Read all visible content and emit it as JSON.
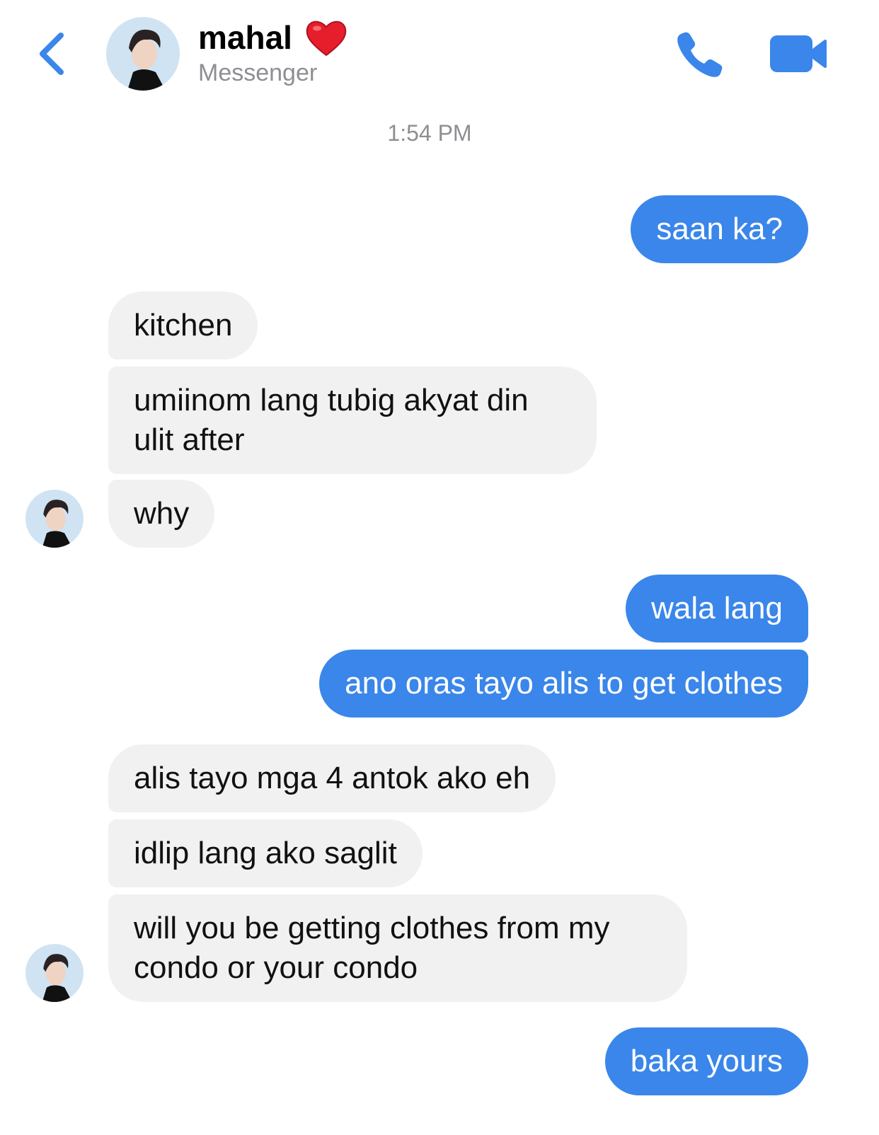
{
  "header": {
    "title": "mahal",
    "subtitle": "Messenger",
    "emoji": "heart-emoji",
    "icons": {
      "back": "chevron-left-icon",
      "call": "phone-icon",
      "video": "video-camera-icon"
    }
  },
  "timestamp": "1:54 PM",
  "messages": [
    {
      "sender": "me",
      "text": "saan ka?"
    },
    {
      "sender": "contact",
      "text": "kitchen"
    },
    {
      "sender": "contact",
      "text": "umiinom lang tubig akyat din ulit after"
    },
    {
      "sender": "contact",
      "text": "why"
    },
    {
      "sender": "me",
      "text": "wala lang"
    },
    {
      "sender": "me",
      "text": "ano oras tayo alis to get clothes"
    },
    {
      "sender": "contact",
      "text": "alis tayo mga 4 antok ako eh"
    },
    {
      "sender": "contact",
      "text": "idlip lang ako saglit"
    },
    {
      "sender": "contact",
      "text": "will you be getting clothes from my condo or your condo"
    },
    {
      "sender": "me",
      "text": "baka yours"
    }
  ],
  "colors": {
    "accent": "#3a86ea",
    "incoming_bubble": "#f1f1f1",
    "outgoing_text": "#ffffff",
    "muted_text": "#8e8e93"
  }
}
